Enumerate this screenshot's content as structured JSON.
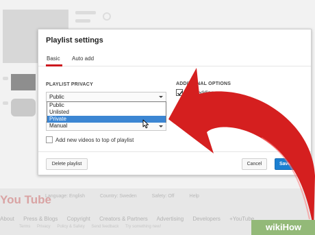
{
  "dialog": {
    "title": "Playlist settings",
    "tabs": [
      "Basic",
      "Auto add"
    ],
    "privacy": {
      "label": "PLAYLIST PRIVACY",
      "selected": "Public",
      "options": [
        "Public",
        "Unlisted",
        "Private"
      ],
      "highlighted": "Private"
    },
    "ordering": {
      "selected": "Manual"
    },
    "add_new_top_label": "Add new videos to top of playlist",
    "additional": {
      "label": "ADDITIONAL OPTIONS",
      "embedding_label": "Embedding"
    },
    "buttons": {
      "delete": "Delete playlist",
      "cancel": "Cancel",
      "save": "Save"
    }
  },
  "footer": {
    "logo": "You Tube",
    "row1": [
      "Language: English",
      "Country: Sweden",
      "Safety: Off",
      "Help"
    ],
    "row2": [
      "About",
      "Press & Blogs",
      "Copyright",
      "Creators & Partners",
      "Advertising",
      "Developers",
      "+YouTube"
    ],
    "row3": [
      "Terms",
      "Privacy",
      "Policy & Safety",
      "Send feedback",
      "Try something new!"
    ]
  },
  "watermark": {
    "wiki": "wiki",
    "how": "How"
  },
  "colors": {
    "arrow": "#d51f1f",
    "accent_tab": "#cc181e",
    "save": "#1b7fd1",
    "highlight": "#3c86d3",
    "wikihow": "#93b978"
  }
}
